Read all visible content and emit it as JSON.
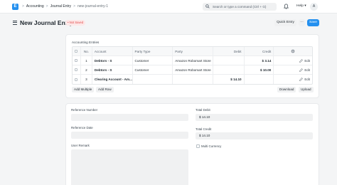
{
  "navbar": {
    "logo_letter": "E",
    "breadcrumbs": [
      "Accounting",
      "Journal Entry",
      "new-journal-entry-1"
    ],
    "search_placeholder": "Search or type a command (Ctrl + G)",
    "help_label": "Help",
    "avatar_initial": "A"
  },
  "page": {
    "title": "New Journal Entry",
    "status_badge": "Not Saved",
    "quick_entry_label": "Quick Entry",
    "more_label": "···",
    "save_label": "Save"
  },
  "accounting_entries": {
    "label": "Accounting Entries",
    "columns": [
      "No.",
      "Account",
      "Party Type",
      "Party",
      "Debit",
      "Credit"
    ],
    "rows": [
      {
        "no": "1",
        "account": "Debtors - S",
        "party_type": "Customer",
        "party": "Amazon Robomart Store",
        "debit": "",
        "credit": "$ 3.14",
        "action": "Edit"
      },
      {
        "no": "2",
        "account": "Debtors - S",
        "party_type": "Customer",
        "party": "Amazon Robomart Store",
        "debit": "",
        "credit": "$ 10.00",
        "action": "Edit"
      },
      {
        "no": "3",
        "account": "Clearing Account - Am...",
        "party_type": "",
        "party": "",
        "debit": "$ 14.10",
        "credit": "",
        "action": "Edit"
      }
    ],
    "add_multiple_label": "Add Multiple",
    "add_row_label": "Add Row",
    "download_label": "Download",
    "upload_label": "Upload"
  },
  "details": {
    "reference_number_label": "Reference Number",
    "reference_number_value": "",
    "reference_date_label": "Reference Date",
    "reference_date_value": "",
    "user_remark_label": "User Remark",
    "user_remark_value": "",
    "total_debit_label": "Total Debit",
    "total_debit_value": "$ 14.10",
    "total_credit_label": "Total Credit",
    "total_credit_value": "$ 14.10",
    "multi_currency_label": "Multi Currency"
  },
  "colors": {
    "primary": "#2490ef",
    "badge_text": "#e24c4c",
    "badge_bg": "#fde8e8"
  },
  "icons": [
    "app-logo",
    "search-icon",
    "bell-icon",
    "hamburger-icon",
    "settings-icon",
    "edit-icon",
    "chevron-right-icon"
  ]
}
